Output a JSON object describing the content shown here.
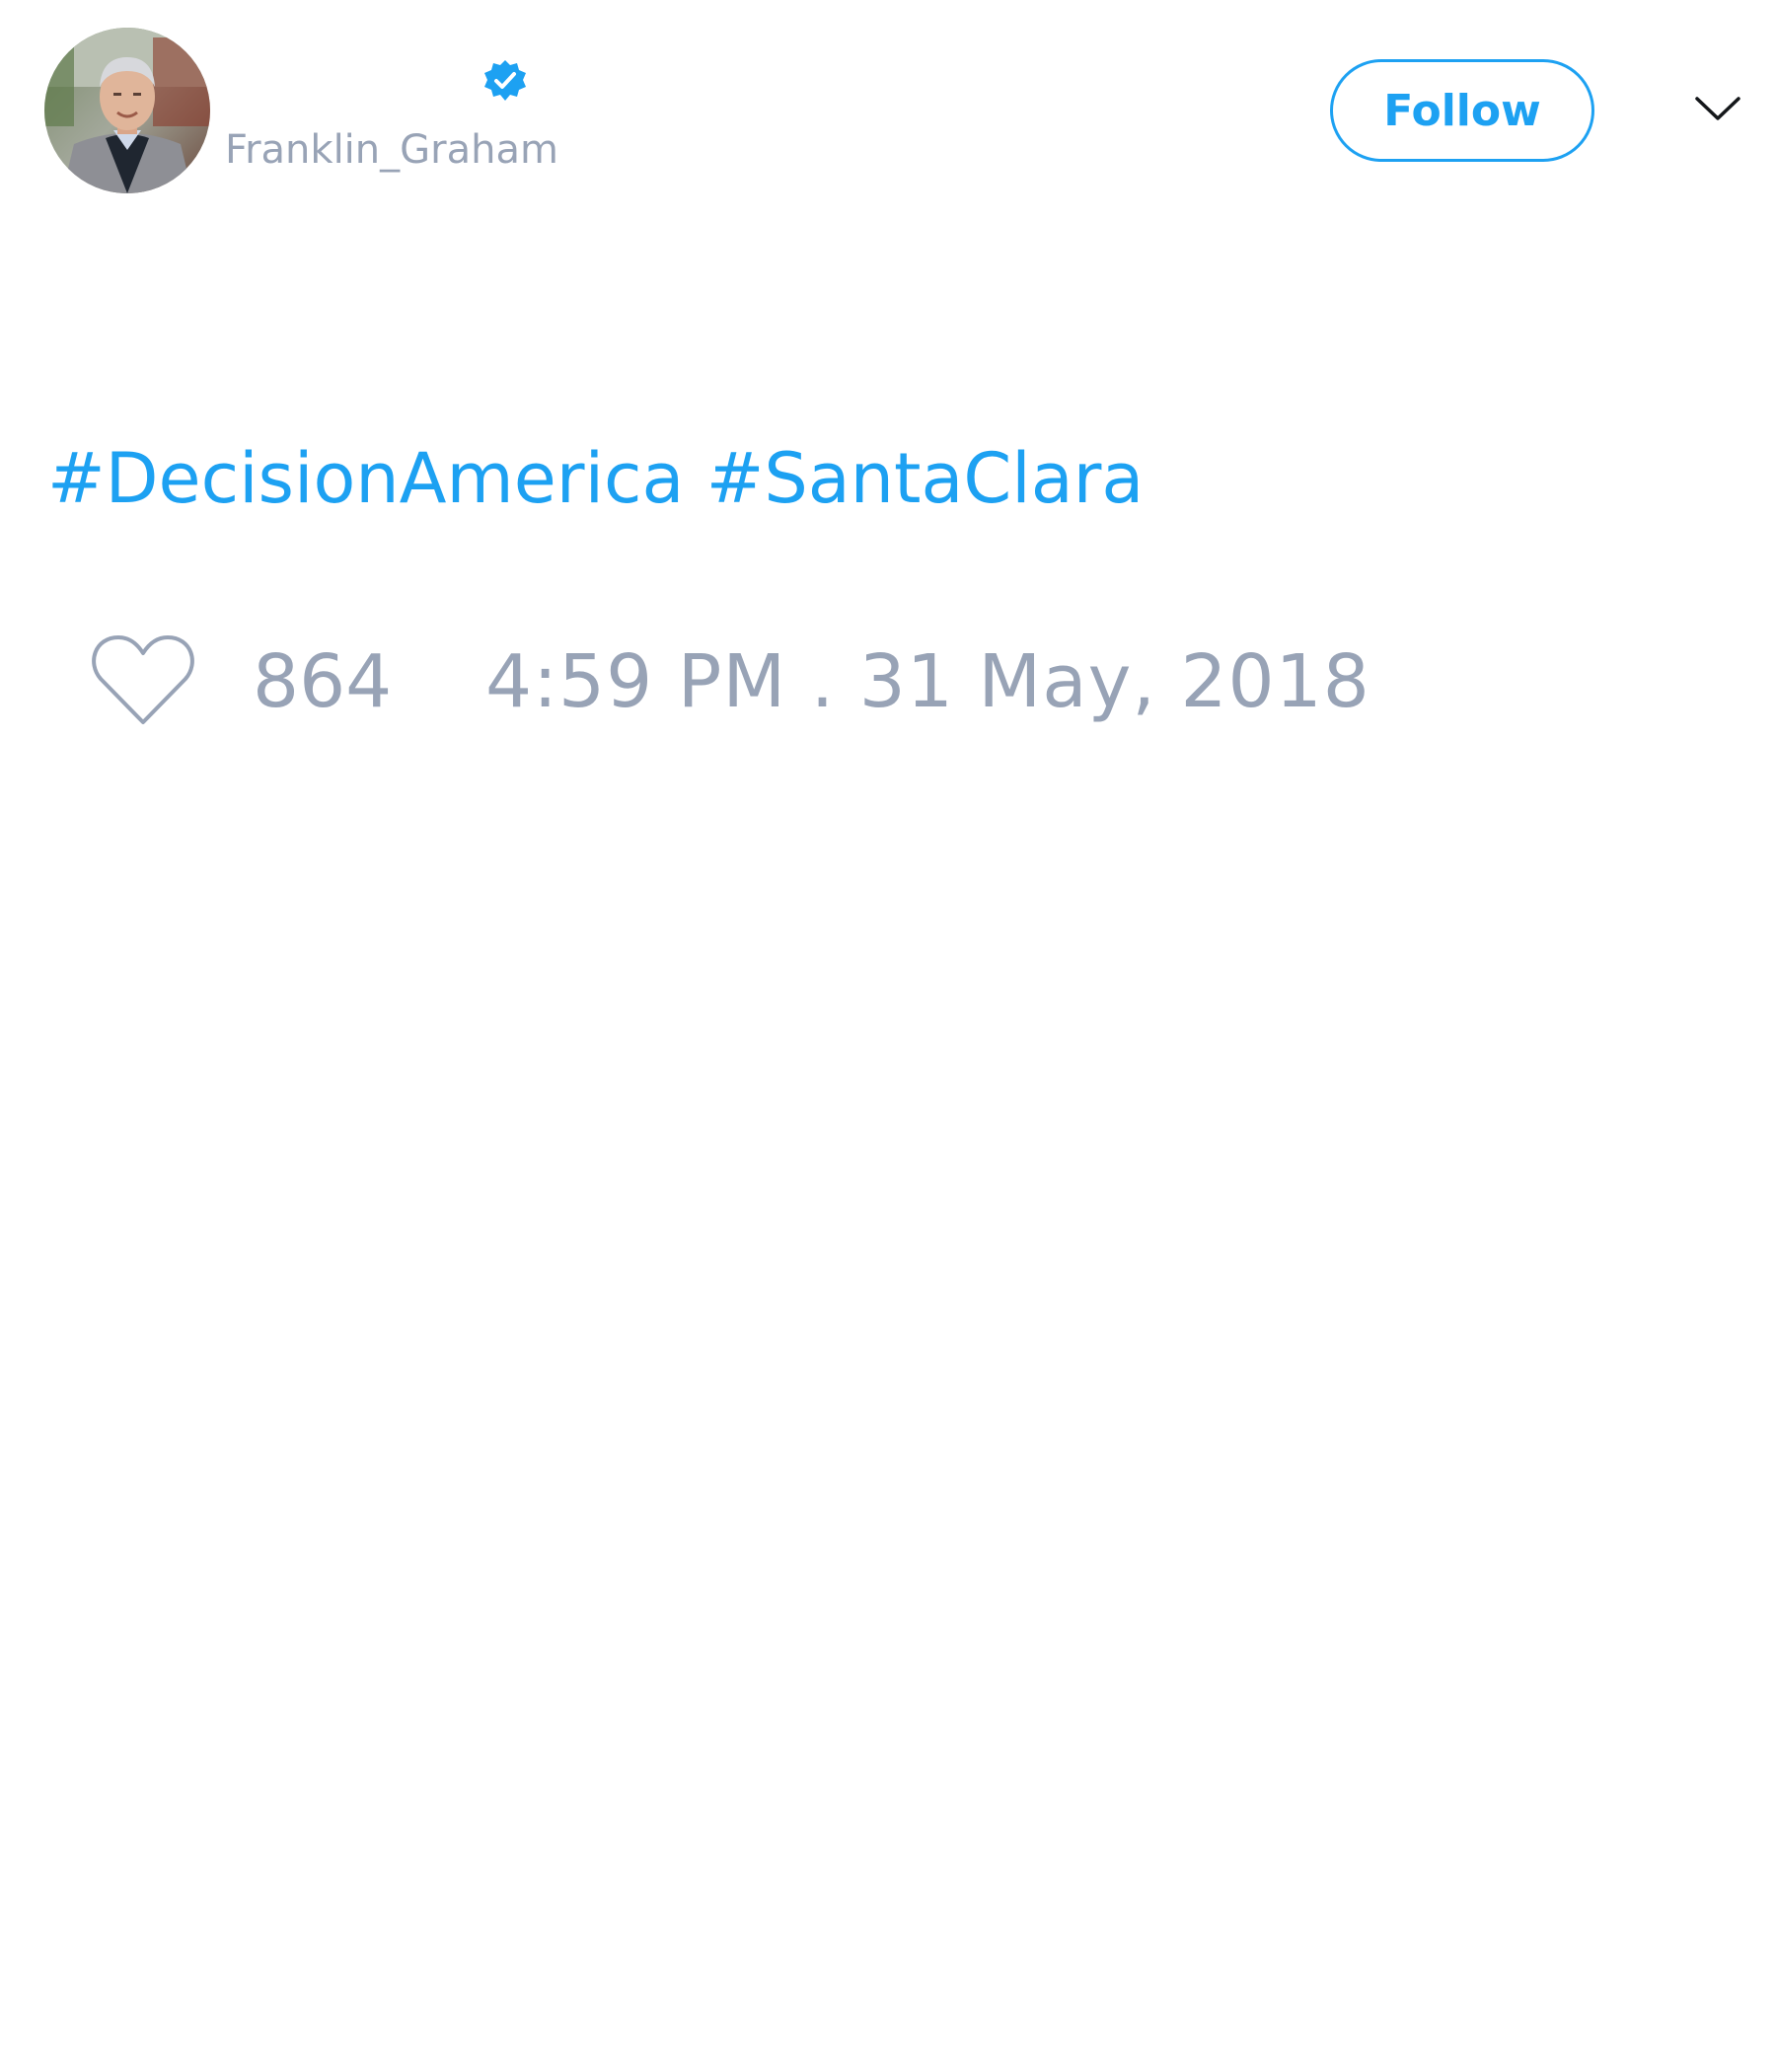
{
  "author": {
    "display_name": "",
    "handle": "Franklin_Graham",
    "verified": true,
    "verified_icon": "verified-badge-icon",
    "avatar_icon": "profile-photo"
  },
  "header": {
    "follow_label": "Follow",
    "menu_icon": "chevron-down-icon"
  },
  "tweet": {
    "hashtags": [
      "#DecisionAmerica",
      "#SantaClara"
    ]
  },
  "footer": {
    "like_icon": "heart-icon",
    "like_count": "864",
    "timestamp": "4:59 PM . 31 May, 2018"
  },
  "colors": {
    "accent": "#1da1f2",
    "muted_text": "#98a3b6"
  }
}
